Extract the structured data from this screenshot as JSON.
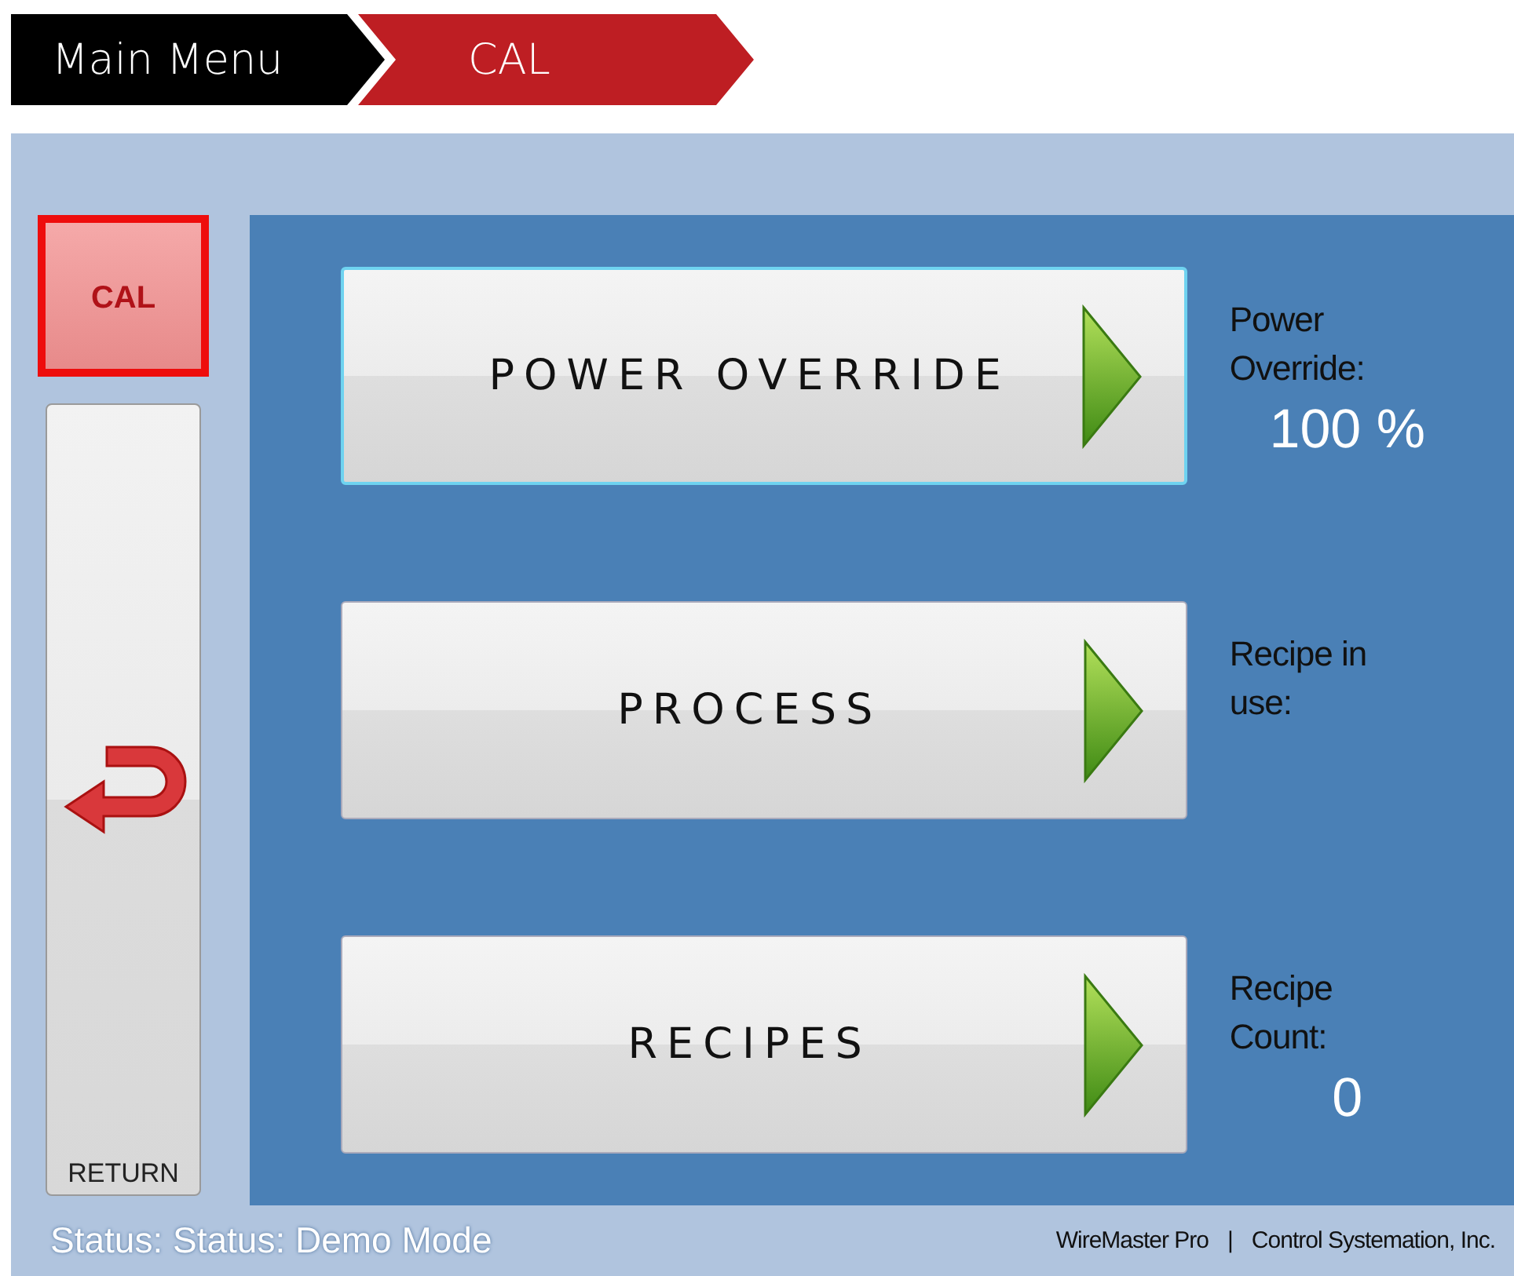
{
  "breadcrumb": [
    {
      "label": "Main Menu",
      "selected": false
    },
    {
      "label": "CAL",
      "selected": true
    }
  ],
  "mode_button": {
    "label": "CAL",
    "selected": true
  },
  "return_button": {
    "label": "RETURN"
  },
  "menu": [
    {
      "label": "POWER OVERRIDE",
      "selected": true,
      "info_label": "Power Override:",
      "value": "100 %"
    },
    {
      "label": "PROCESS",
      "selected": false,
      "info_label": "Recipe in use:"
    },
    {
      "label": "RECIPES",
      "selected": false,
      "info_label": "Recipe Count:",
      "value": "0"
    }
  ],
  "status_bar": {
    "status": "Status: Status: Demo Mode",
    "product": "WireMaster Pro",
    "separator": "|",
    "company": "Control Systemation, Inc."
  }
}
